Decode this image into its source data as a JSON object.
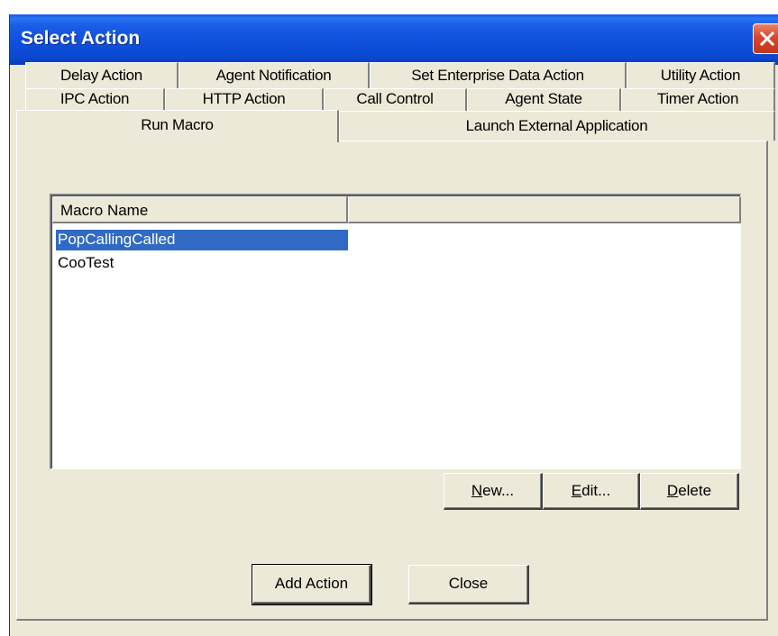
{
  "window": {
    "title": "Select Action"
  },
  "tabs": {
    "row1": [
      {
        "label": "Delay Action"
      },
      {
        "label": "Agent Notification"
      },
      {
        "label": "Set Enterprise Data Action"
      },
      {
        "label": "Utility Action"
      }
    ],
    "row2": [
      {
        "label": "IPC Action"
      },
      {
        "label": "HTTP Action"
      },
      {
        "label": "Call Control"
      },
      {
        "label": "Agent State"
      },
      {
        "label": "Timer Action"
      }
    ],
    "row3": [
      {
        "label": "Run Macro",
        "active": true
      },
      {
        "label": "Launch External Application",
        "active": false
      }
    ]
  },
  "macro_list": {
    "column_header": "Macro Name",
    "items": [
      {
        "name": "PopCallingCalled",
        "selected": true
      },
      {
        "name": "CooTest",
        "selected": false
      }
    ]
  },
  "list_buttons": {
    "new_first": "N",
    "new_rest": "ew...",
    "edit_first": "E",
    "edit_rest": "dit...",
    "delete_first": "D",
    "delete_rest": "elete"
  },
  "footer_buttons": {
    "add_action": "Add Action",
    "close": "Close"
  },
  "colors": {
    "titlebar": "#0a48d0",
    "selection": "#316ac5",
    "dialog_bg": "#ece9d8"
  }
}
